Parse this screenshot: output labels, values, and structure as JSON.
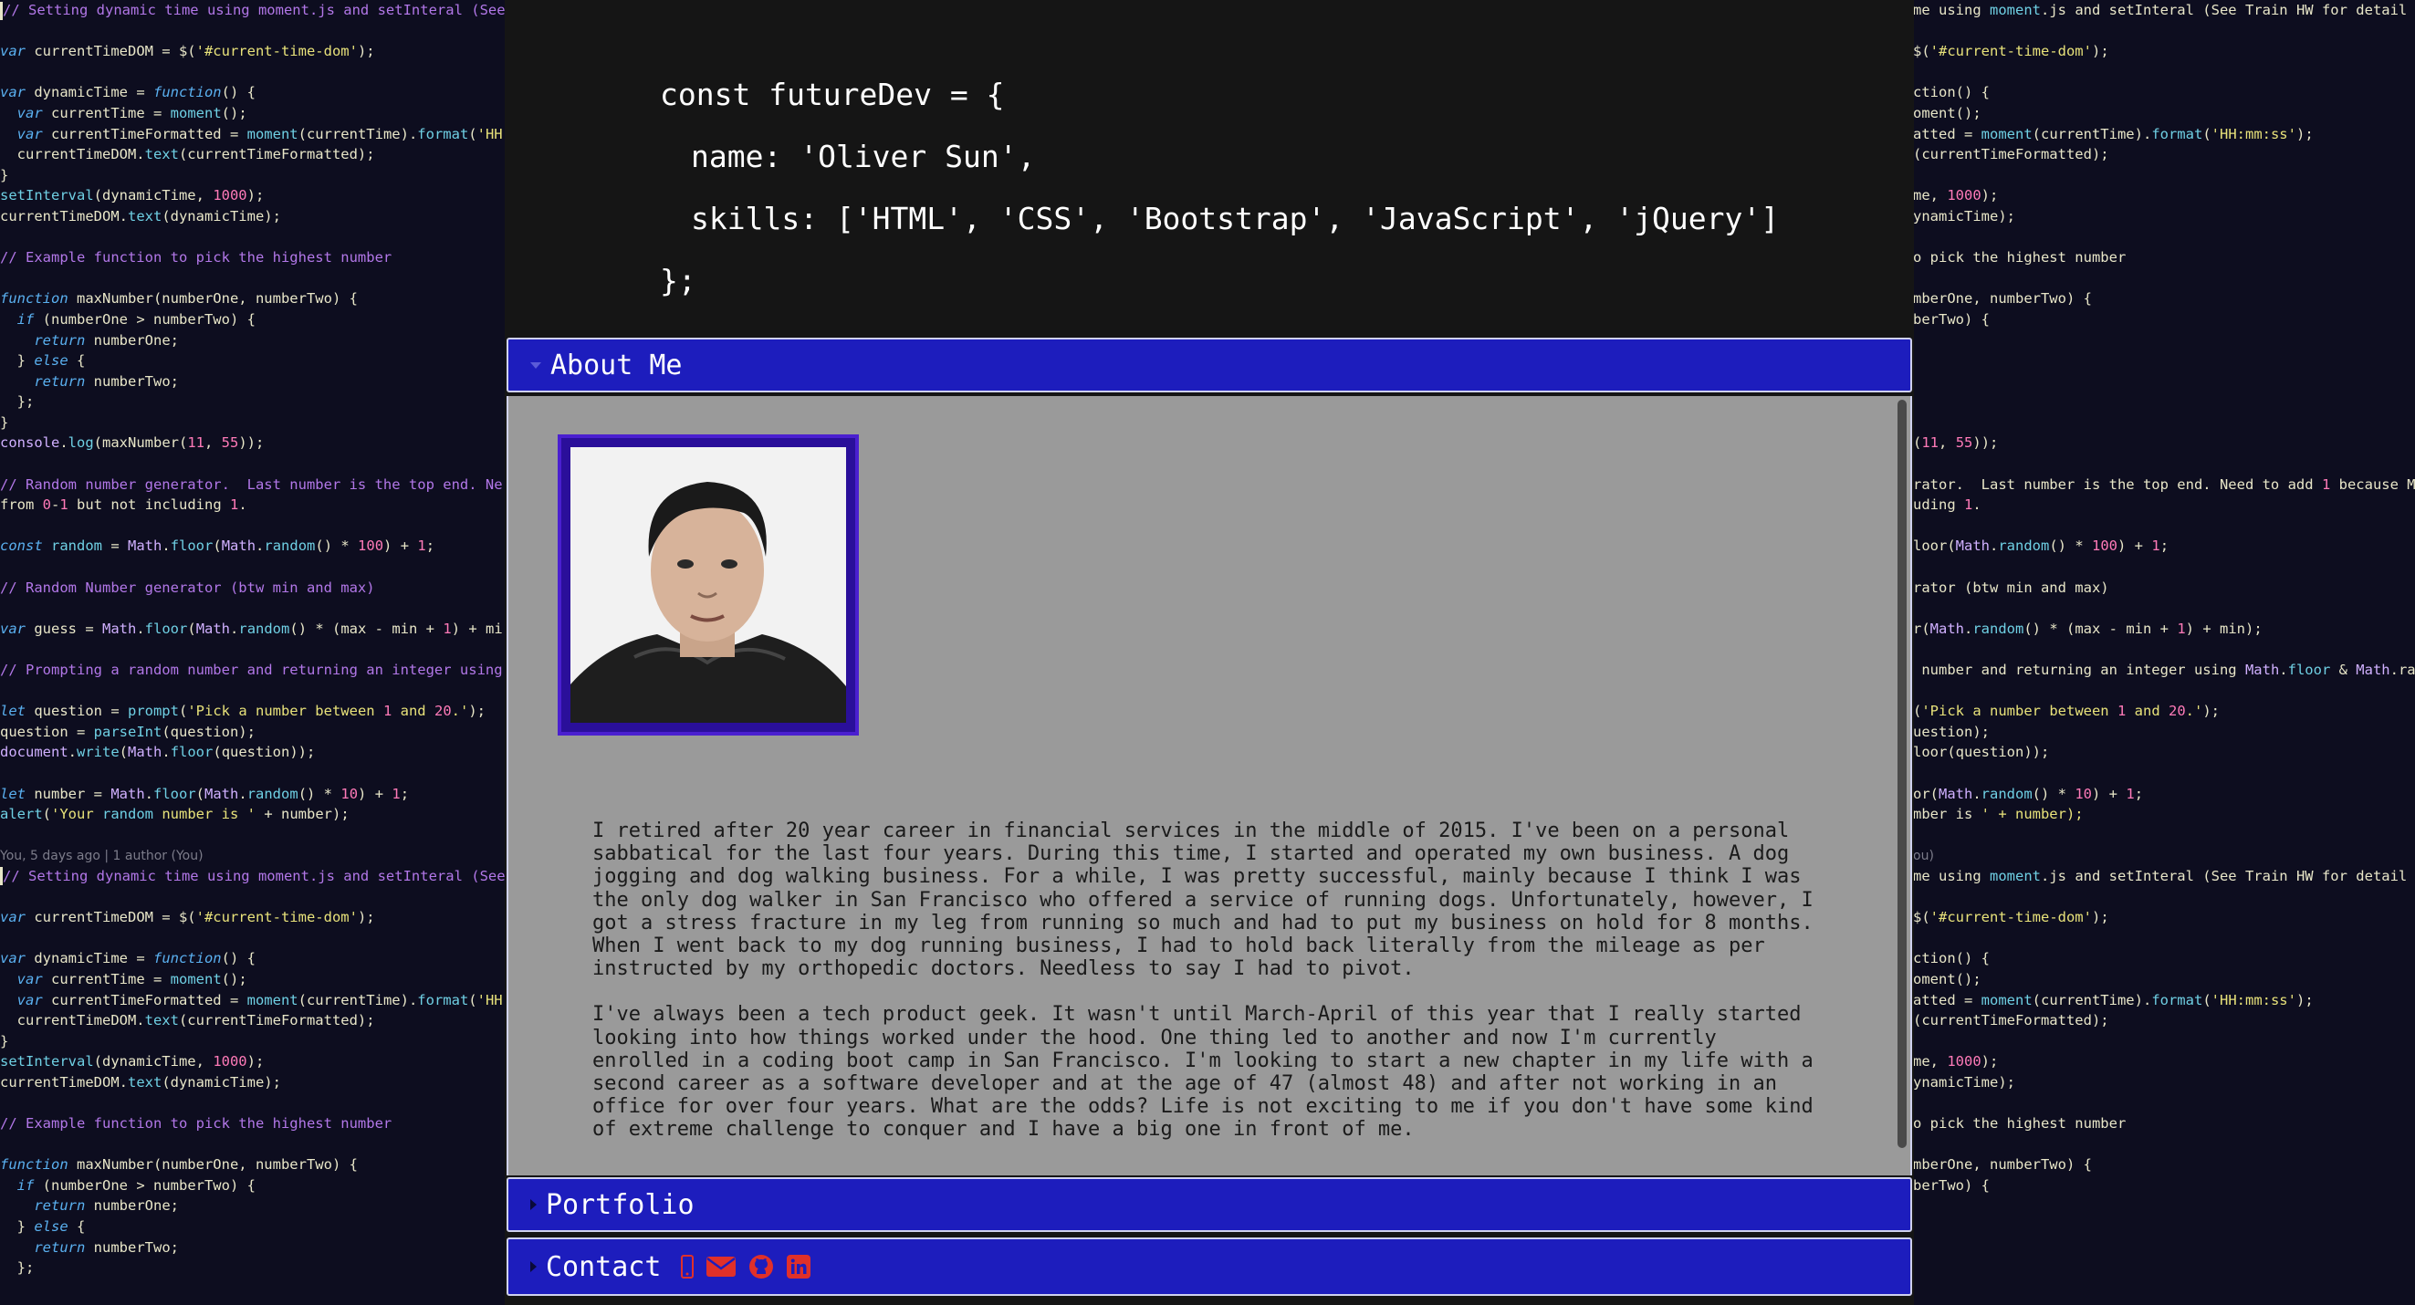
{
  "hero": {
    "line1": "const futureDev = {",
    "line2": "name: 'Oliver Sun',",
    "line3": "skills: ['HTML', 'CSS', 'Bootstrap', 'JavaScript', 'jQuery']",
    "line4": "};"
  },
  "sections": {
    "about": {
      "label": "About Me"
    },
    "portfolio": {
      "label": "Portfolio"
    },
    "contact": {
      "label": "Contact"
    }
  },
  "about": {
    "paragraph1": "I retired after 20 year career in financial services in the middle of 2015. I've been on a personal sabbatical for the last four years. During this time, I started and operated my own business. A dog jogging and dog walking business. For a while, I was pretty successful, mainly because I think I was the only dog walker in San Francisco who offered a service of running dogs. Unfortunately, however, I got a stress fracture in my leg from running so much and had to put my business on hold for 8 months. When I went back to my dog running business, I had to hold back literally from the mileage as per instructed by my orthopedic doctors. Needless to say I had to pivot.",
    "paragraph2": "I've always been a tech product geek. It wasn't until March-April of this year that I really started looking into how things worked under the hood. One thing led to another and now I'm currently enrolled in a coding boot camp in San Francisco. I'm looking to start a new chapter in my life with a second career as a software developer and at the age of 47 (almost 48) and after not working in an office for over four years. What are the odds? Life is not exciting to me if you don't have some kind of extreme challenge to conquer and I have a big one in front of me."
  },
  "contact_icons": [
    "phone-icon",
    "envelope-icon",
    "github-icon",
    "linkedin-icon"
  ],
  "colors": {
    "accordion": "#1d1dbd",
    "icon": "#e0302a",
    "panel": "#9a9a9a",
    "frame": "#2a0f9a"
  },
  "background_code": {
    "left": [
      "// Setting dynamic time using moment.js and setInteral (See",
      "",
      "var currentTimeDOM = $('#current-time-dom');",
      "",
      "var dynamicTime = function() {",
      "  var currentTime = moment();",
      "  var currentTimeFormatted = moment(currentTime).format('HH",
      "  currentTimeDOM.text(currentTimeFormatted);",
      "}",
      "setInterval(dynamicTime, 1000);",
      "currentTimeDOM.text(dynamicTime);",
      "",
      "// Example function to pick the highest number",
      "",
      "function maxNumber(numberOne, numberTwo) {",
      "  if (numberOne > numberTwo) {",
      "    return numberOne;",
      "  } else {",
      "    return numberTwo;",
      "  };",
      "}",
      "console.log(maxNumber(11, 55));",
      "",
      "// Random number generator.  Last number is the top end. Ne",
      "from 0-1 but not including 1.",
      "",
      "const random = Math.floor(Math.random() * 100) + 1;",
      "",
      "// Random Number generator (btw min and max)",
      "",
      "var guess = Math.floor(Math.random() * (max - min + 1) + mi",
      "",
      "// Prompting a random number and returning an integer using",
      "",
      "let question = prompt('Pick a number between 1 and 20.');",
      "question = parseInt(question);",
      "document.write(Math.floor(question));",
      "",
      "let number = Math.floor(Math.random() * 10) + 1;",
      "alert('Your random number is ' + number);",
      "",
      "You, 5 days ago | 1 author (You)",
      "// Setting dynamic time using moment.js and setInteral (See",
      "",
      "var currentTimeDOM = $('#current-time-dom');",
      "",
      "var dynamicTime = function() {",
      "  var currentTime = moment();",
      "  var currentTimeFormatted = moment(currentTime).format('HH",
      "  currentTimeDOM.text(currentTimeFormatted);",
      "}",
      "setInterval(dynamicTime, 1000);",
      "currentTimeDOM.text(dynamicTime);",
      "",
      "// Example function to pick the highest number",
      "",
      "function maxNumber(numberOne, numberTwo) {",
      "  if (numberOne > numberTwo) {",
      "    return numberOne;",
      "  } else {",
      "    return numberTwo;",
      "  };"
    ],
    "right": [
      "me using moment.js and setInteral (See Train HW for detail",
      "",
      "$('#current-time-dom');",
      "",
      "ction() {",
      "oment();",
      "atted = moment(currentTime).format('HH:mm:ss');",
      "(currentTimeFormatted);",
      "",
      "me, 1000);",
      "ynamicTime);",
      "",
      "o pick the highest number",
      "",
      "mberOne, numberTwo) {",
      "berTwo) {",
      "",
      "",
      "",
      "",
      "",
      "(11, 55));",
      "",
      "rator.  Last number is the top end. Need to add 1 because M",
      "uding 1.",
      "",
      "loor(Math.random() * 100) + 1;",
      "",
      "rator (btw min and max)",
      "",
      "r(Math.random() * (max - min + 1) + min);",
      "",
      " number and returning an integer using Math.floor & Math.ra",
      "",
      "('Pick a number between 1 and 20.');",
      "uestion);",
      "loor(question));",
      "",
      "or(Math.random() * 10) + 1;",
      "mber is ' + number);",
      "",
      "ou)",
      "me using moment.js and setInteral (See Train HW for detail",
      "",
      "$('#current-time-dom');",
      "",
      "ction() {",
      "oment();",
      "atted = moment(currentTime).format('HH:mm:ss');",
      "(currentTimeFormatted);",
      "",
      "me, 1000);",
      "ynamicTime);",
      "",
      "o pick the highest number",
      "",
      "mberOne, numberTwo) {",
      "berTwo) {"
    ]
  }
}
